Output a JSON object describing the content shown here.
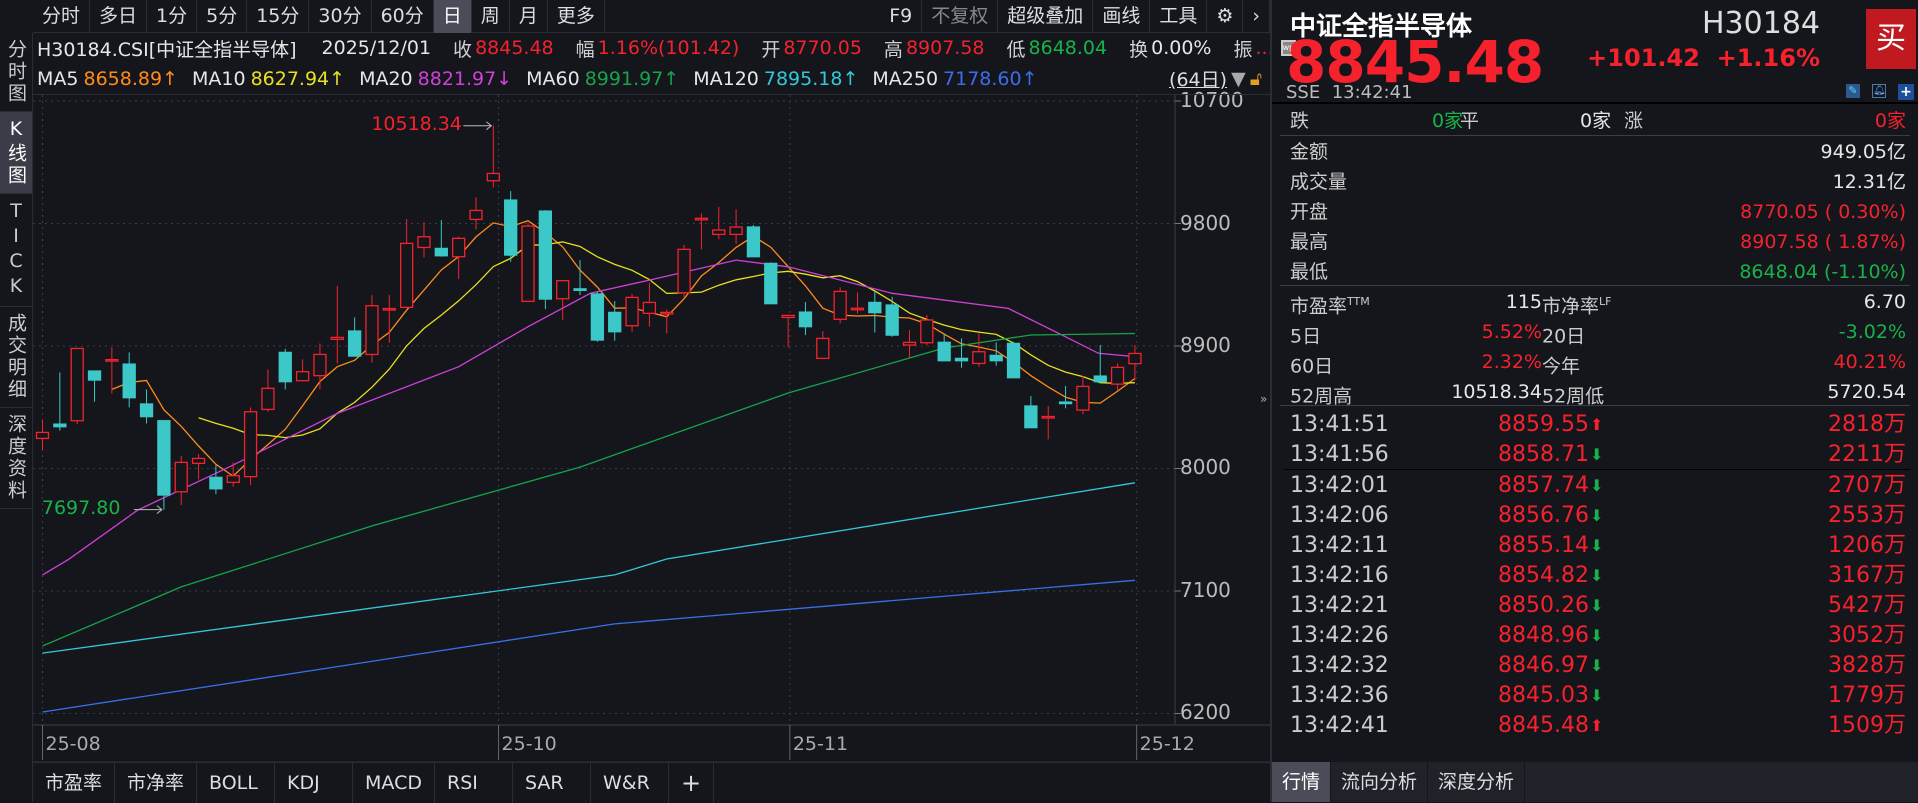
{
  "toolbar": {
    "periods": [
      "分时",
      "多日",
      "1分",
      "5分",
      "15分",
      "30分",
      "60分",
      "日",
      "周",
      "月",
      "更多"
    ],
    "active_period": "日",
    "right": [
      "F9",
      "不复权",
      "超级叠加",
      "画线",
      "工具"
    ],
    "gear_icon": "gear-icon",
    "more_icon": "chevron-right-icon"
  },
  "info": {
    "code": "H30184.CSI[中证全指半导体]",
    "date": "2025/12/01",
    "close_label": "收",
    "close": "8845.48",
    "change_label": "幅",
    "change": "1.16%(101.42)",
    "open_label": "开",
    "open": "8770.05",
    "high_label": "高",
    "high": "8907.58",
    "low_label": "低",
    "low": "8648.04",
    "turnover_label": "换",
    "turnover": "0.00%",
    "amplitude_label": "振",
    "amplitude_more": "..."
  },
  "ma_row": {
    "items": [
      {
        "label": "MA5",
        "value": "8658.89↑",
        "color": "#ff8c1a"
      },
      {
        "label": "MA10",
        "value": "8627.94↑",
        "color": "#e8e020"
      },
      {
        "label": "MA20",
        "value": "8821.97↓",
        "color": "#d040d8"
      },
      {
        "label": "MA60",
        "value": "8991.97↑",
        "color": "#16a34a"
      },
      {
        "label": "MA120",
        "value": "7895.18↑",
        "color": "#33c8d8"
      },
      {
        "label": "MA250",
        "value": "7178.60↑",
        "color": "#3a6ee8"
      }
    ],
    "days": "(64日)"
  },
  "left_tabs": [
    "分时图",
    "K线图",
    "TICK",
    "成交明细",
    "深度资料"
  ],
  "active_left_tab": "K线图",
  "indicator_tabs": [
    "市盈率",
    "市净率",
    "BOLL",
    "KDJ",
    "MACD",
    "RSI",
    "SAR",
    "W&R",
    "+"
  ],
  "chart_data": {
    "type": "candlestick",
    "title": "",
    "up_color": "#f5222d",
    "down_color": "#3cc8c8",
    "ylim": [
      6200,
      10700
    ],
    "yticks": [
      "10700",
      "9800",
      "8900",
      "8000",
      "7100",
      "6200"
    ],
    "xticks": [
      {
        "label": "25-08",
        "index": 0
      },
      {
        "label": "25-10",
        "index": 26.3
      },
      {
        "label": "25-11",
        "index": 43.1
      },
      {
        "label": "25-12",
        "index": 63.1
      }
    ],
    "grid": true,
    "annotations": [
      {
        "label": "10518.34",
        "index": 26,
        "price": 10518.34,
        "color": "#f5222d"
      },
      {
        "label": "7697.80",
        "index": 7,
        "price": 7697.8,
        "color": "#17b34a"
      }
    ],
    "ohlc": [
      [
        8221,
        8356,
        8135,
        8265
      ],
      [
        8326,
        8706,
        8278,
        8307
      ],
      [
        8351,
        8882,
        8326,
        8882
      ],
      [
        8716,
        8716,
        8491,
        8650
      ],
      [
        8795,
        8890,
        8552,
        8800
      ],
      [
        8767,
        8853,
        8449,
        8520
      ],
      [
        8474,
        8581,
        8331,
        8381
      ],
      [
        8351,
        8351,
        7697.8,
        7805
      ],
      [
        7829,
        8091,
        7731,
        8045
      ],
      [
        8038,
        8106,
        7920,
        8074
      ],
      [
        7935,
        8025,
        7812,
        7851
      ],
      [
        7898,
        8045,
        7866,
        7947
      ],
      [
        7940,
        8449,
        7878,
        8417
      ],
      [
        8434,
        8728,
        8417,
        8589
      ],
      [
        8853,
        8878,
        8581,
        8638
      ],
      [
        8645,
        8802,
        8645,
        8711
      ],
      [
        8682,
        8919,
        8581,
        8838
      ],
      [
        8949,
        9340,
        8772,
        8963
      ],
      [
        9010,
        9110,
        8821,
        8826
      ],
      [
        8838,
        9274,
        8777,
        9196
      ],
      [
        9170,
        9274,
        8924,
        9175
      ],
      [
        9184,
        9833,
        9184,
        9654
      ],
      [
        9624,
        9808,
        9551,
        9703
      ],
      [
        9617,
        9825,
        9556,
        9563
      ],
      [
        9556,
        9703,
        9392,
        9691
      ],
      [
        9830,
        9992,
        9757,
        9896
      ],
      [
        10114,
        10518.34,
        10065,
        10168
      ],
      [
        9972,
        10038,
        9519,
        9568
      ],
      [
        9228,
        9801,
        9228,
        9781
      ],
      [
        9891,
        9899,
        9171,
        9245
      ],
      [
        9247,
        9380,
        9091,
        9380
      ],
      [
        9320,
        9531,
        9274,
        9315
      ],
      [
        9282,
        9299,
        8931,
        8944
      ],
      [
        9147,
        9230,
        8939,
        9005
      ],
      [
        9049,
        9282,
        9005,
        9257
      ],
      [
        9140,
        9365,
        9042,
        9220
      ],
      [
        9145,
        9169,
        8993,
        9147
      ],
      [
        9291,
        9642,
        9262,
        9610
      ],
      [
        9836,
        9874,
        9610,
        9838
      ],
      [
        9720,
        9923,
        9683,
        9752
      ],
      [
        9720,
        9904,
        9649,
        9774
      ],
      [
        9774,
        9789,
        9556,
        9556
      ],
      [
        9507,
        9514,
        9211,
        9211
      ],
      [
        9110,
        9125,
        8890,
        9125
      ],
      [
        9149,
        9223,
        8980,
        9042
      ],
      [
        8809,
        9010,
        8809,
        8956
      ],
      [
        9096,
        9331,
        9066,
        9301
      ],
      [
        9175,
        9294,
        9140,
        9177
      ],
      [
        9220,
        9299,
        9000,
        9145
      ],
      [
        9201,
        9262,
        8968,
        8980
      ],
      [
        8907,
        9017,
        8809,
        8927
      ],
      [
        8924,
        9127,
        8907,
        9091
      ],
      [
        8927,
        8993,
        8792,
        8792
      ],
      [
        8809,
        8956,
        8740,
        8792
      ],
      [
        8772,
        8993,
        8748,
        8858
      ],
      [
        8831,
        8927,
        8755,
        8792
      ],
      [
        8919,
        8931,
        8667,
        8667
      ],
      [
        8459,
        8532,
        8300,
        8300
      ],
      [
        8378,
        8459,
        8214,
        8382
      ],
      [
        8488,
        8606,
        8442,
        8478
      ],
      [
        8429,
        8679,
        8400,
        8603
      ],
      [
        8679,
        8907,
        8625,
        8638
      ],
      [
        8620,
        8772,
        8576,
        8743
      ],
      [
        8770.05,
        8907.58,
        8648.04,
        8845.48
      ]
    ],
    "ma_lines": [
      {
        "name": "MA5",
        "color": "#ff8c1a",
        "period": 5
      },
      {
        "name": "MA10",
        "color": "#e8e020",
        "period": 10
      },
      {
        "name": "MA20",
        "color": "#d040d8",
        "points": [
          [
            0,
            7218
          ],
          [
            1.5,
            7332
          ],
          [
            5.5,
            7695
          ],
          [
            10.8,
            8013
          ],
          [
            17,
            8405
          ],
          [
            24,
            8748
          ],
          [
            28,
            9042
          ],
          [
            31.6,
            9287
          ],
          [
            35,
            9384
          ],
          [
            40,
            9531
          ],
          [
            43,
            9482
          ],
          [
            49,
            9287
          ],
          [
            55.7,
            9176
          ],
          [
            58.8,
            8980
          ],
          [
            60.9,
            8846
          ],
          [
            63,
            8821.97
          ]
        ]
      },
      {
        "name": "MA60",
        "color": "#16a34a",
        "points": [
          [
            0,
            6696
          ],
          [
            8,
            7130
          ],
          [
            19,
            7578
          ],
          [
            31,
            8010
          ],
          [
            43,
            8555
          ],
          [
            52,
            8885
          ],
          [
            57,
            8981
          ],
          [
            63,
            8991.97
          ]
        ]
      },
      {
        "name": "MA120",
        "color": "#33c8d8",
        "points": [
          [
            0,
            6644
          ],
          [
            33,
            7218
          ],
          [
            36,
            7335
          ],
          [
            63,
            7895.18
          ]
        ]
      },
      {
        "name": "MA250",
        "color": "#3a6ee8",
        "points": [
          [
            0,
            6211
          ],
          [
            33,
            6858
          ],
          [
            63,
            7178.6
          ]
        ]
      }
    ]
  },
  "quote": {
    "name": "中证全指半导体",
    "code": "H30184",
    "price": "8845.48",
    "change": "+101.42",
    "change_pct": "+1.16%",
    "buy_label": "买",
    "exchange": "SSE",
    "time": "13:42:41",
    "breadth": {
      "down_label": "跌",
      "down": "0家",
      "flat_label": "平",
      "flat": "0家",
      "up_label": "涨",
      "up": "0家"
    },
    "stats": [
      {
        "label": "金额",
        "value": "949.05亿",
        "color": "#e6e6e6"
      },
      {
        "label": "成交量",
        "value": "12.31亿",
        "color": "#e6e6e6"
      },
      {
        "label": "开盘",
        "value": "8770.05 ( 0.30%)",
        "color": "#f5222d"
      },
      {
        "label": "最高",
        "value": "8907.58 ( 1.87%)",
        "color": "#f5222d"
      },
      {
        "label": "最低",
        "value": "8648.04 (-1.10%)",
        "color": "#17b34a"
      }
    ],
    "pairs": [
      {
        "l1": "市盈率",
        "s1": "TTM",
        "v1": "115",
        "c1": "#e6e6e6",
        "l2": "市净率",
        "s2": "LF",
        "v2": "6.70",
        "c2": "#e6e6e6"
      },
      {
        "l1": "5日",
        "s1": "",
        "v1": "5.52%",
        "c1": "#f5222d",
        "l2": "20日",
        "s2": "",
        "v2": "-3.02%",
        "c2": "#17b34a"
      },
      {
        "l1": "60日",
        "s1": "",
        "v1": "2.32%",
        "c1": "#f5222d",
        "l2": "今年",
        "s2": "",
        "v2": "40.21%",
        "c2": "#f5222d"
      },
      {
        "l1": "52周高",
        "s1": "",
        "v1": "10518.34",
        "c1": "#e6e6e6",
        "l2": "52周低",
        "s2": "",
        "v2": "5720.54",
        "c2": "#e6e6e6"
      }
    ],
    "ticks": [
      {
        "time": "13:41:51",
        "price": "8859.55",
        "dir": "up",
        "vol": "2818万"
      },
      {
        "time": "13:41:56",
        "price": "8858.71",
        "dir": "down",
        "vol": "2211万"
      },
      {
        "time": "13:42:01",
        "price": "8857.74",
        "dir": "down",
        "vol": "2707万"
      },
      {
        "time": "13:42:06",
        "price": "8856.76",
        "dir": "down",
        "vol": "2553万"
      },
      {
        "time": "13:42:11",
        "price": "8855.14",
        "dir": "down",
        "vol": "1206万"
      },
      {
        "time": "13:42:16",
        "price": "8854.82",
        "dir": "down",
        "vol": "3167万"
      },
      {
        "time": "13:42:21",
        "price": "8850.26",
        "dir": "down",
        "vol": "5427万"
      },
      {
        "time": "13:42:26",
        "price": "8848.96",
        "dir": "down",
        "vol": "3052万"
      },
      {
        "time": "13:42:32",
        "price": "8846.97",
        "dir": "down",
        "vol": "3828万"
      },
      {
        "time": "13:42:36",
        "price": "8845.03",
        "dir": "down",
        "vol": "1779万"
      },
      {
        "time": "13:42:41",
        "price": "8845.48",
        "dir": "up",
        "vol": "1509万"
      }
    ],
    "tabs": [
      "行情",
      "流向分析",
      "深度分析"
    ],
    "active_tab": "行情"
  }
}
